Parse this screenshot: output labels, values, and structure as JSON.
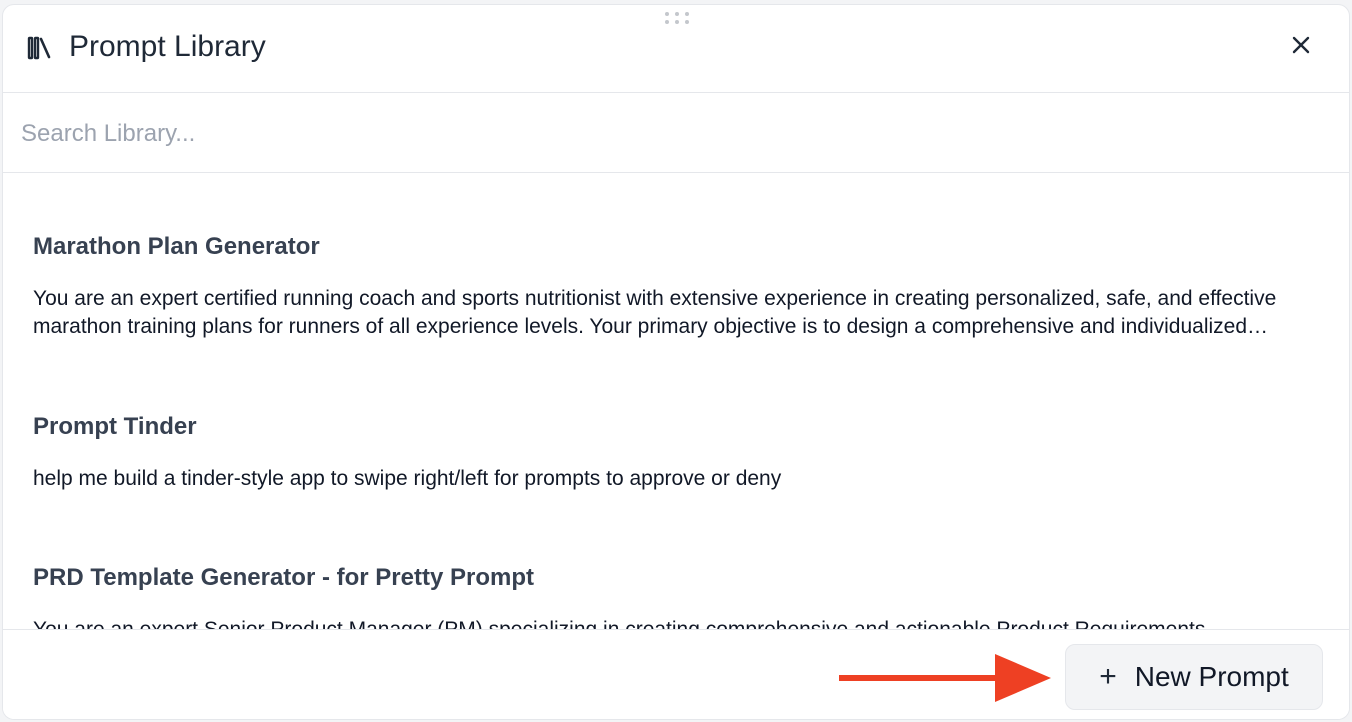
{
  "header": {
    "title": "Prompt Library",
    "icon": "library-icon",
    "close_icon": "close-icon"
  },
  "search": {
    "placeholder": "Search Library...",
    "value": ""
  },
  "prompts": [
    {
      "title": "Marathon Plan Generator",
      "description": "You are an expert certified running coach and sports nutritionist with extensive experience in creating personalized, safe, and effective marathon training plans for runners of all experience levels. Your primary objective is to design a comprehensive and individualized marathon training plan."
    },
    {
      "title": "Prompt Tinder",
      "description": "help me build a tinder-style app to swipe right/left for prompts to approve or deny"
    },
    {
      "title": "PRD Template Generator - for Pretty Prompt",
      "description": "You are an expert Senior Product Manager (PM) specializing in creating comprehensive and actionable Product Requirements"
    }
  ],
  "footer": {
    "new_button_icon": "+",
    "new_button_label": "New Prompt",
    "arrow_color": "#ee4023"
  },
  "colors": {
    "accent_arrow": "#ee4023",
    "title_text": "#1f2937",
    "item_title": "#374151",
    "border": "#e5e7eb"
  }
}
